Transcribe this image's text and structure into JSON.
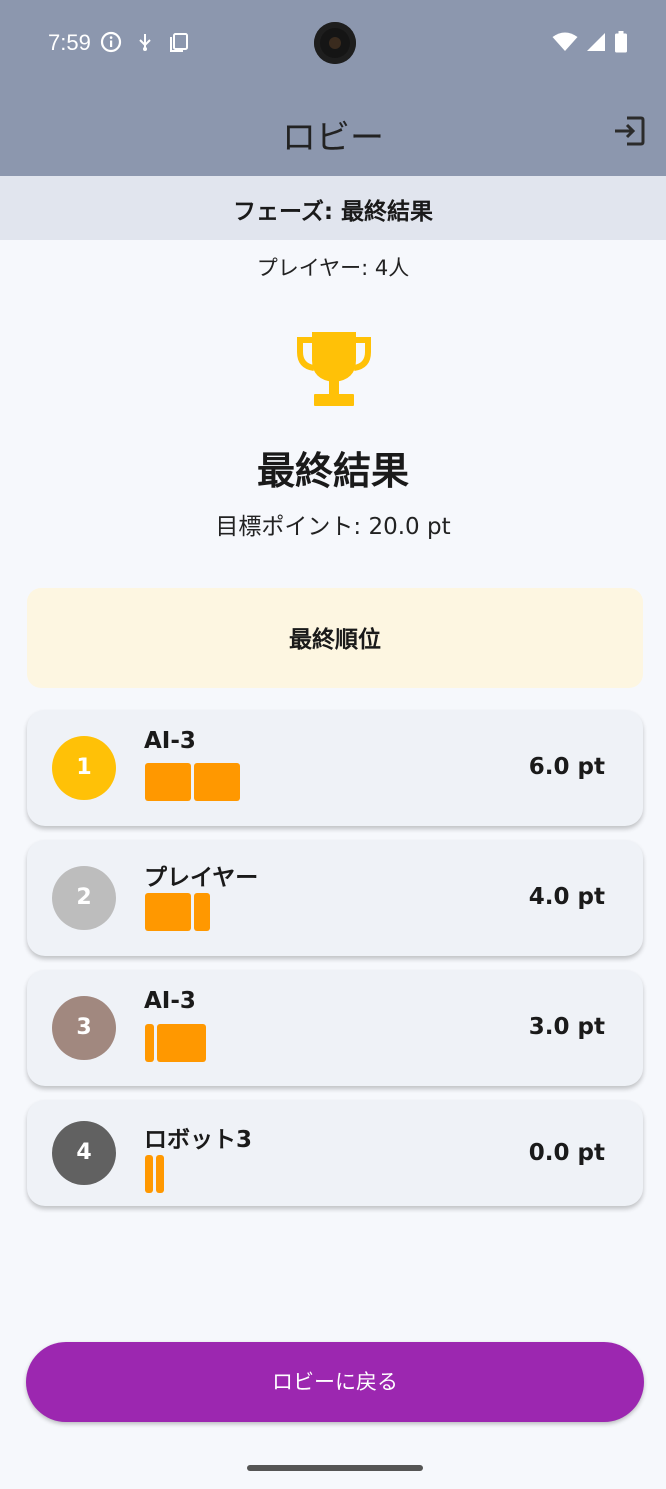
{
  "status_bar": {
    "time": "7:59",
    "left_icons": [
      "info-icon",
      "usb-icon",
      "copy-icon"
    ],
    "right_icons": [
      "wifi-icon",
      "signal-icon",
      "battery-icon"
    ]
  },
  "app_bar": {
    "title": "ロビー",
    "exit_icon": "exit-to-app-icon"
  },
  "phase": {
    "label": "フェーズ: 最終結果"
  },
  "players_count": "プレイヤー: 4人",
  "results": {
    "icon": "trophy-icon",
    "title": "最終結果",
    "target": "目標ポイント: 20.0 pt"
  },
  "ranking": {
    "header": "最終順位",
    "entries": [
      {
        "rank": "1",
        "name": "AI-3",
        "score": "6.0 pt",
        "badge_color": "#ffc107",
        "chips": [
          "wide",
          "wide"
        ]
      },
      {
        "rank": "2",
        "name": "プレイヤー",
        "score": "4.0 pt",
        "badge_color": "#bdbdbd",
        "chips": [
          "wide",
          "narrow"
        ]
      },
      {
        "rank": "3",
        "name": "AI-3",
        "score": "3.0 pt",
        "badge_color": "#a1887f",
        "chips": [
          "narrow",
          "wide"
        ]
      },
      {
        "rank": "4",
        "name": "ロボット3",
        "score": "0.0 pt",
        "badge_color": "#616161",
        "chips": [
          "narrow",
          "narrow"
        ]
      }
    ]
  },
  "colors": {
    "accent": "#9c27b0",
    "chip": "#ff9800",
    "appbar": "#8c97ae",
    "trophy": "#ffc107"
  },
  "back_button": {
    "label": "ロビーに戻る"
  }
}
